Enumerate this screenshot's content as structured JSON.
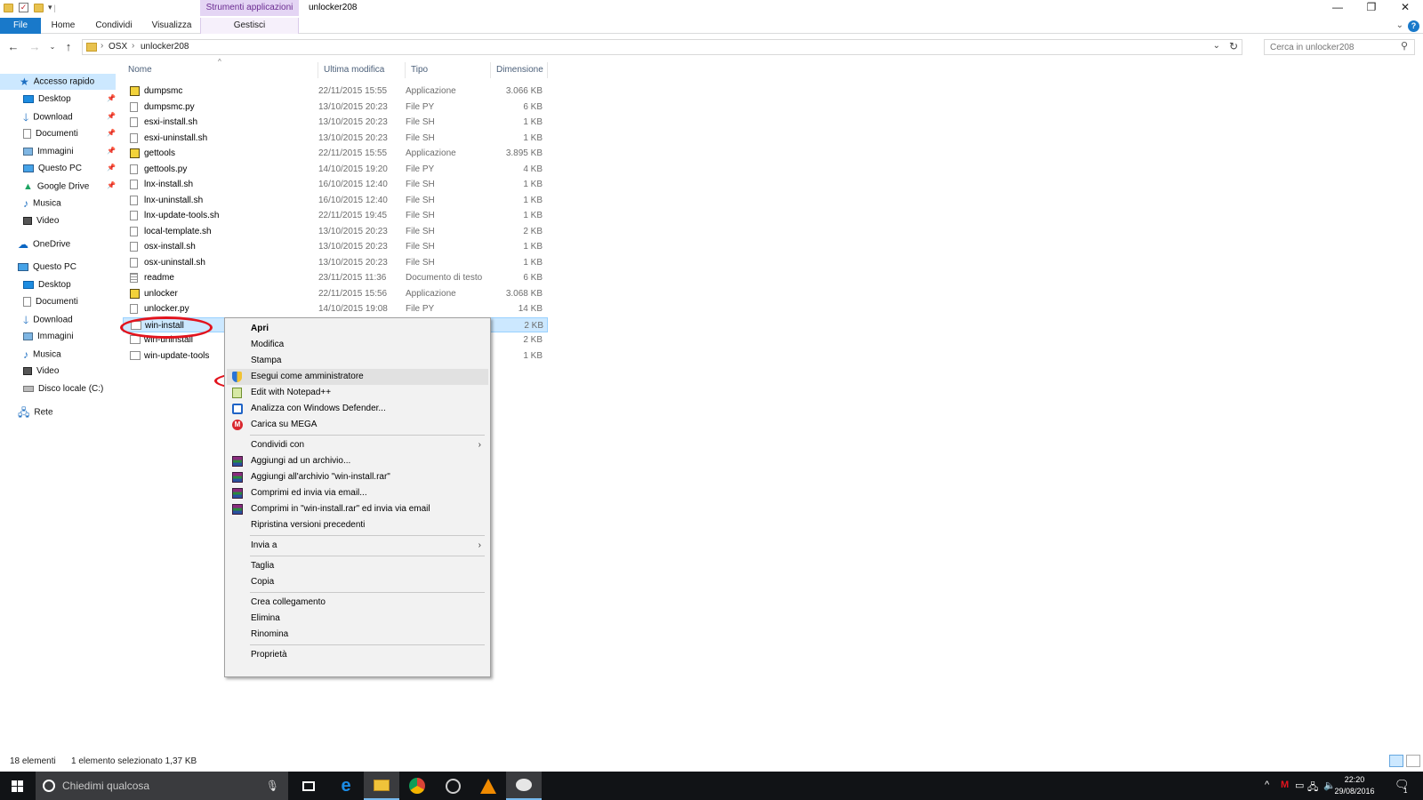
{
  "window": {
    "title": "unlocker208",
    "tool_tab_header": "Strumenti applicazioni",
    "controls": {
      "minimize": "—",
      "restore": "❐",
      "close": "✕"
    }
  },
  "ribbon": {
    "tabs": [
      "File",
      "Home",
      "Condividi",
      "Visualizza",
      "Gestisci"
    ],
    "accent": "#1979ca"
  },
  "address": {
    "crumbs": [
      "OSX",
      "unlocker208"
    ],
    "search_placeholder": "Cerca in unlocker208"
  },
  "nav": {
    "quick_access": "Accesso rapido",
    "quick_items": [
      "Desktop",
      "Download",
      "Documenti",
      "Immagini",
      "Questo PC",
      "Google Drive",
      "Musica",
      "Video"
    ],
    "onedrive": "OneDrive",
    "this_pc": "Questo PC",
    "pc_items": [
      "Desktop",
      "Documenti",
      "Download",
      "Immagini",
      "Musica",
      "Video",
      "Disco locale (C:)"
    ],
    "network": "Rete"
  },
  "columns": {
    "name": "Nome",
    "modified": "Ultima modifica",
    "type": "Tipo",
    "size": "Dimensione"
  },
  "files": [
    {
      "name": "dumpsmc",
      "date": "22/11/2015 15:55",
      "type": "Applicazione",
      "size": "3.066 KB",
      "icon": "app"
    },
    {
      "name": "dumpsmc.py",
      "date": "13/10/2015 20:23",
      "type": "File PY",
      "size": "6 KB",
      "icon": "file"
    },
    {
      "name": "esxi-install.sh",
      "date": "13/10/2015 20:23",
      "type": "File SH",
      "size": "1 KB",
      "icon": "file"
    },
    {
      "name": "esxi-uninstall.sh",
      "date": "13/10/2015 20:23",
      "type": "File SH",
      "size": "1 KB",
      "icon": "file"
    },
    {
      "name": "gettools",
      "date": "22/11/2015 15:55",
      "type": "Applicazione",
      "size": "3.895 KB",
      "icon": "app"
    },
    {
      "name": "gettools.py",
      "date": "14/10/2015 19:20",
      "type": "File PY",
      "size": "4 KB",
      "icon": "file"
    },
    {
      "name": "lnx-install.sh",
      "date": "16/10/2015 12:40",
      "type": "File SH",
      "size": "1 KB",
      "icon": "file"
    },
    {
      "name": "lnx-uninstall.sh",
      "date": "16/10/2015 12:40",
      "type": "File SH",
      "size": "1 KB",
      "icon": "file"
    },
    {
      "name": "lnx-update-tools.sh",
      "date": "22/11/2015 19:45",
      "type": "File SH",
      "size": "1 KB",
      "icon": "file"
    },
    {
      "name": "local-template.sh",
      "date": "13/10/2015 20:23",
      "type": "File SH",
      "size": "2 KB",
      "icon": "file"
    },
    {
      "name": "osx-install.sh",
      "date": "13/10/2015 20:23",
      "type": "File SH",
      "size": "1 KB",
      "icon": "file"
    },
    {
      "name": "osx-uninstall.sh",
      "date": "13/10/2015 20:23",
      "type": "File SH",
      "size": "1 KB",
      "icon": "file"
    },
    {
      "name": "readme",
      "date": "23/11/2015 11:36",
      "type": "Documento di testo",
      "size": "6 KB",
      "icon": "txt"
    },
    {
      "name": "unlocker",
      "date": "22/11/2015 15:56",
      "type": "Applicazione",
      "size": "3.068 KB",
      "icon": "app"
    },
    {
      "name": "unlocker.py",
      "date": "14/10/2015 19:08",
      "type": "File PY",
      "size": "14 KB",
      "icon": "file"
    },
    {
      "name": "win-install",
      "date": "",
      "type": "",
      "size": "2 KB",
      "icon": "cmd",
      "selected": true
    },
    {
      "name": "win-uninstall",
      "date": "",
      "type": "",
      "size": "2 KB",
      "icon": "cmd"
    },
    {
      "name": "win-update-tools",
      "date": "",
      "type": "",
      "size": "1 KB",
      "icon": "cmd"
    }
  ],
  "context_menu": {
    "items": [
      {
        "label": "Apri",
        "bold": true
      },
      {
        "label": "Modifica"
      },
      {
        "label": "Stampa"
      },
      {
        "label": "Esegui come amministratore",
        "icon": "shield-icon",
        "highlighted": true
      },
      {
        "label": "Edit with Notepad++",
        "icon": "notepadpp-icon"
      },
      {
        "label": "Analizza con Windows Defender...",
        "icon": "defender-icon"
      },
      {
        "label": "Carica su MEGA",
        "icon": "mega-icon"
      },
      {
        "separator": true
      },
      {
        "label": "Condividi con",
        "submenu": true
      },
      {
        "label": "Aggiungi ad un archivio...",
        "icon": "winrar-icon"
      },
      {
        "label": "Aggiungi all'archivio \"win-install.rar\"",
        "icon": "winrar-icon"
      },
      {
        "label": "Comprimi ed invia via email...",
        "icon": "winrar-icon"
      },
      {
        "label": "Comprimi in \"win-install.rar\" ed invia via email",
        "icon": "winrar-icon"
      },
      {
        "label": "Ripristina versioni precedenti"
      },
      {
        "separator": true
      },
      {
        "label": "Invia a",
        "submenu": true
      },
      {
        "separator": true
      },
      {
        "label": "Taglia"
      },
      {
        "label": "Copia"
      },
      {
        "separator": true
      },
      {
        "label": "Crea collegamento"
      },
      {
        "label": "Elimina"
      },
      {
        "label": "Rinomina"
      },
      {
        "separator": true
      },
      {
        "label": "Proprietà"
      }
    ]
  },
  "status": {
    "count": "18 elementi",
    "selection": "1 elemento selezionato  1,37 KB"
  },
  "taskbar": {
    "search_placeholder": "Chiedimi qualcosa",
    "time": "22:20",
    "date": "29/08/2016",
    "notifications": "1"
  },
  "annotation_color": "#e2131d"
}
